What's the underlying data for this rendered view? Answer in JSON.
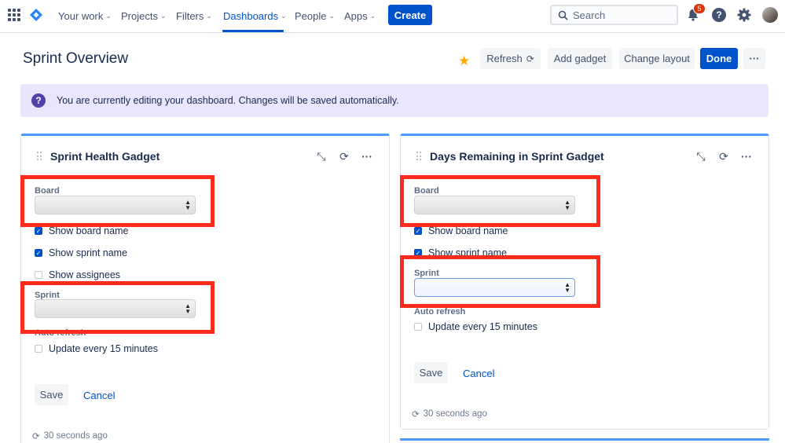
{
  "nav": {
    "items": [
      {
        "label": "Your work"
      },
      {
        "label": "Projects"
      },
      {
        "label": "Filters"
      },
      {
        "label": "Dashboards"
      },
      {
        "label": "People"
      },
      {
        "label": "Apps"
      }
    ],
    "create_label": "Create",
    "search_placeholder": "Search",
    "notification_count": "5",
    "help_glyph": "?"
  },
  "page": {
    "title": "Sprint Overview",
    "buttons": {
      "refresh": "Refresh",
      "add_gadget": "Add gadget",
      "change_layout": "Change layout",
      "done": "Done",
      "more": "···"
    }
  },
  "banner": {
    "icon_glyph": "?",
    "text": "You are currently editing your dashboard. Changes will be saved automatically."
  },
  "gadgets": [
    {
      "title": "Sprint Health Gadget",
      "board_label": "Board",
      "show_board_name": "Show board name",
      "show_sprint_name": "Show sprint name",
      "show_assignees": "Show assignees",
      "sprint_label": "Sprint",
      "auto_refresh_label": "Auto refresh",
      "update_every": "Update every 15 minutes",
      "save": "Save",
      "cancel": "Cancel",
      "updated": "30 seconds ago"
    },
    {
      "title": "Days Remaining in Sprint Gadget",
      "board_label": "Board",
      "show_board_name": "Show board name",
      "show_sprint_name": "Show sprint name",
      "sprint_label": "Sprint",
      "auto_refresh_label": "Auto refresh",
      "update_every": "Update every 15 minutes",
      "save": "Save",
      "cancel": "Cancel",
      "updated": "30 seconds ago"
    }
  ],
  "colors": {
    "brand": "#0052CC",
    "highlight": "#FF2B1C",
    "banner_bg": "#EAE6FF",
    "star": "#FFAB00",
    "badge": "#DE350B"
  }
}
